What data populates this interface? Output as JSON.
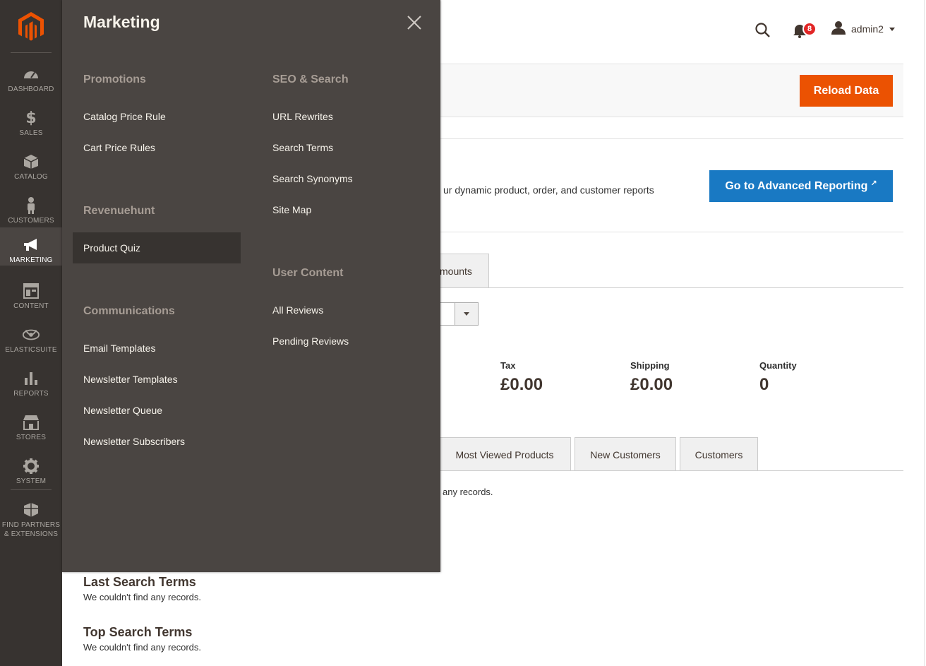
{
  "nav": {
    "items": [
      {
        "label": "DASHBOARD",
        "icon": "dashboard-icon"
      },
      {
        "label": "SALES",
        "icon": "dollar-icon"
      },
      {
        "label": "CATALOG",
        "icon": "box-icon"
      },
      {
        "label": "CUSTOMERS",
        "icon": "person-icon"
      },
      {
        "label": "MARKETING",
        "icon": "megaphone-icon"
      },
      {
        "label": "CONTENT",
        "icon": "layout-icon"
      },
      {
        "label": "ELASTICSUITE",
        "icon": "elasticsuite-icon"
      },
      {
        "label": "REPORTS",
        "icon": "bar-chart-icon"
      },
      {
        "label": "STORES",
        "icon": "store-icon"
      },
      {
        "label": "SYSTEM",
        "icon": "gear-icon"
      },
      {
        "label": "FIND PARTNERS & EXTENSIONS",
        "icon": "extensions-icon"
      }
    ],
    "active": "MARKETING"
  },
  "header": {
    "notification_count": "8",
    "username": "admin2"
  },
  "actions": {
    "reload_label": "Reload Data"
  },
  "advanced": {
    "text_partial": "ur dynamic product, order, and customer reports",
    "button_label": "Go to Advanced Reporting",
    "ext_icon": "↗"
  },
  "chart_tabs": {
    "amounts_partial": "mounts"
  },
  "totals": {
    "tax_label": "Tax",
    "tax_value": "£0.00",
    "shipping_label": "Shipping",
    "shipping_value": "£0.00",
    "quantity_label": "Quantity",
    "quantity_value": "0"
  },
  "grid_tabs": {
    "most_viewed": "Most Viewed Products",
    "new_customers": "New Customers",
    "customers": "Customers",
    "no_records_partial": "any records."
  },
  "sections": {
    "last_search_title": "Last Search Terms",
    "last_search_empty": "We couldn't find any records.",
    "top_search_title": "Top Search Terms",
    "top_search_empty": "We couldn't find any records."
  },
  "flyout": {
    "title": "Marketing",
    "promotions": {
      "title": "Promotions",
      "items": [
        "Catalog Price Rule",
        "Cart Price Rules"
      ]
    },
    "revenuehunt": {
      "title": "Revenuehunt",
      "items": [
        "Product Quiz"
      ]
    },
    "communications": {
      "title": "Communications",
      "items": [
        "Email Templates",
        "Newsletter Templates",
        "Newsletter Queue",
        "Newsletter Subscribers"
      ]
    },
    "seo": {
      "title": "SEO & Search",
      "items": [
        "URL Rewrites",
        "Search Terms",
        "Search Synonyms",
        "Site Map"
      ]
    },
    "user_content": {
      "title": "User Content",
      "items": [
        "All Reviews",
        "Pending Reviews"
      ]
    }
  },
  "colors": {
    "nav_bg": "#373330",
    "flyout_bg": "#4a4542",
    "accent_orange": "#eb5202",
    "accent_blue": "#1979c3",
    "badge_red": "#e22626"
  }
}
